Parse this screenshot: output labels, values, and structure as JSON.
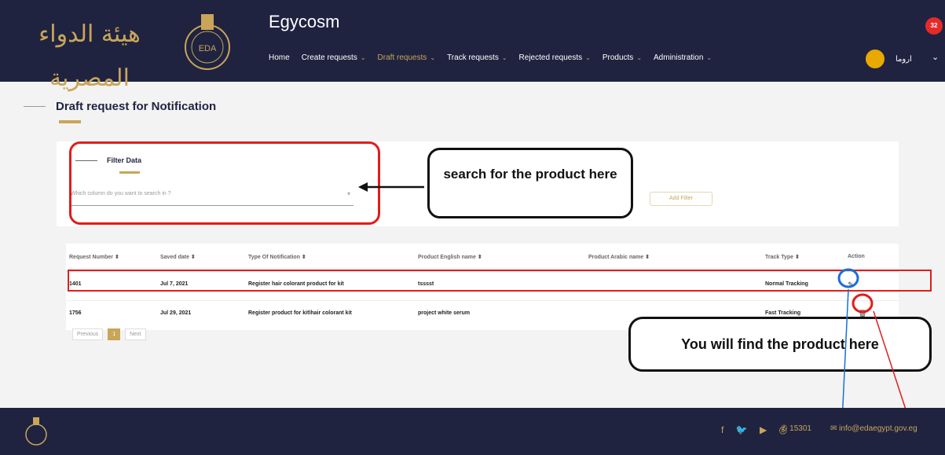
{
  "header": {
    "logo_text_ar": "هيئة الدواء المصرية",
    "seal_text": "EDA",
    "app_title": "Egycosm",
    "notification_count": "32",
    "user_name": "اروما",
    "nav": [
      {
        "label": "Home"
      },
      {
        "label": "Create requests"
      },
      {
        "label": "Draft requests"
      },
      {
        "label": "Track requests"
      },
      {
        "label": "Rejected requests"
      },
      {
        "label": "Products"
      },
      {
        "label": "Administration"
      }
    ]
  },
  "page": {
    "title": "Draft request for Notification"
  },
  "filter": {
    "title": "Filter Data",
    "select_placeholder": "Which column do you want to search in ?",
    "add_filter_label": "Add Filter"
  },
  "table": {
    "columns": [
      "Request Number ⬍",
      "Saved date ⬍",
      "Type Of Notification ⬍",
      "Product English name ⬍",
      "Product Arabic name ⬍",
      "Track Type ⬍",
      "Action"
    ],
    "rows": [
      {
        "request_number": "1401",
        "saved_date": "Jul 7, 2021",
        "type": "Register hair colorant product for kit",
        "english_name": "tsssst",
        "arabic_name": "",
        "track_type": "Normal Tracking"
      },
      {
        "request_number": "1756",
        "saved_date": "Jul 29, 2021",
        "type": "Register product for kit\\hair colorant kit",
        "english_name": "project white serum",
        "arabic_name": "",
        "track_type": "Fast Tracking"
      }
    ]
  },
  "pagination": {
    "previous": "Previous",
    "current": "1",
    "next": "Next"
  },
  "annotations": {
    "search_callout": "search for the product here",
    "product_callout": "You will find the product here"
  },
  "footer": {
    "phone": "15301",
    "email": "info@edaegypt.gov.eg"
  },
  "colors": {
    "navy": "#1f2340",
    "gold": "#c9a55a",
    "annotation_red": "#e21c1c",
    "annotation_blue": "#1a6fd6"
  }
}
